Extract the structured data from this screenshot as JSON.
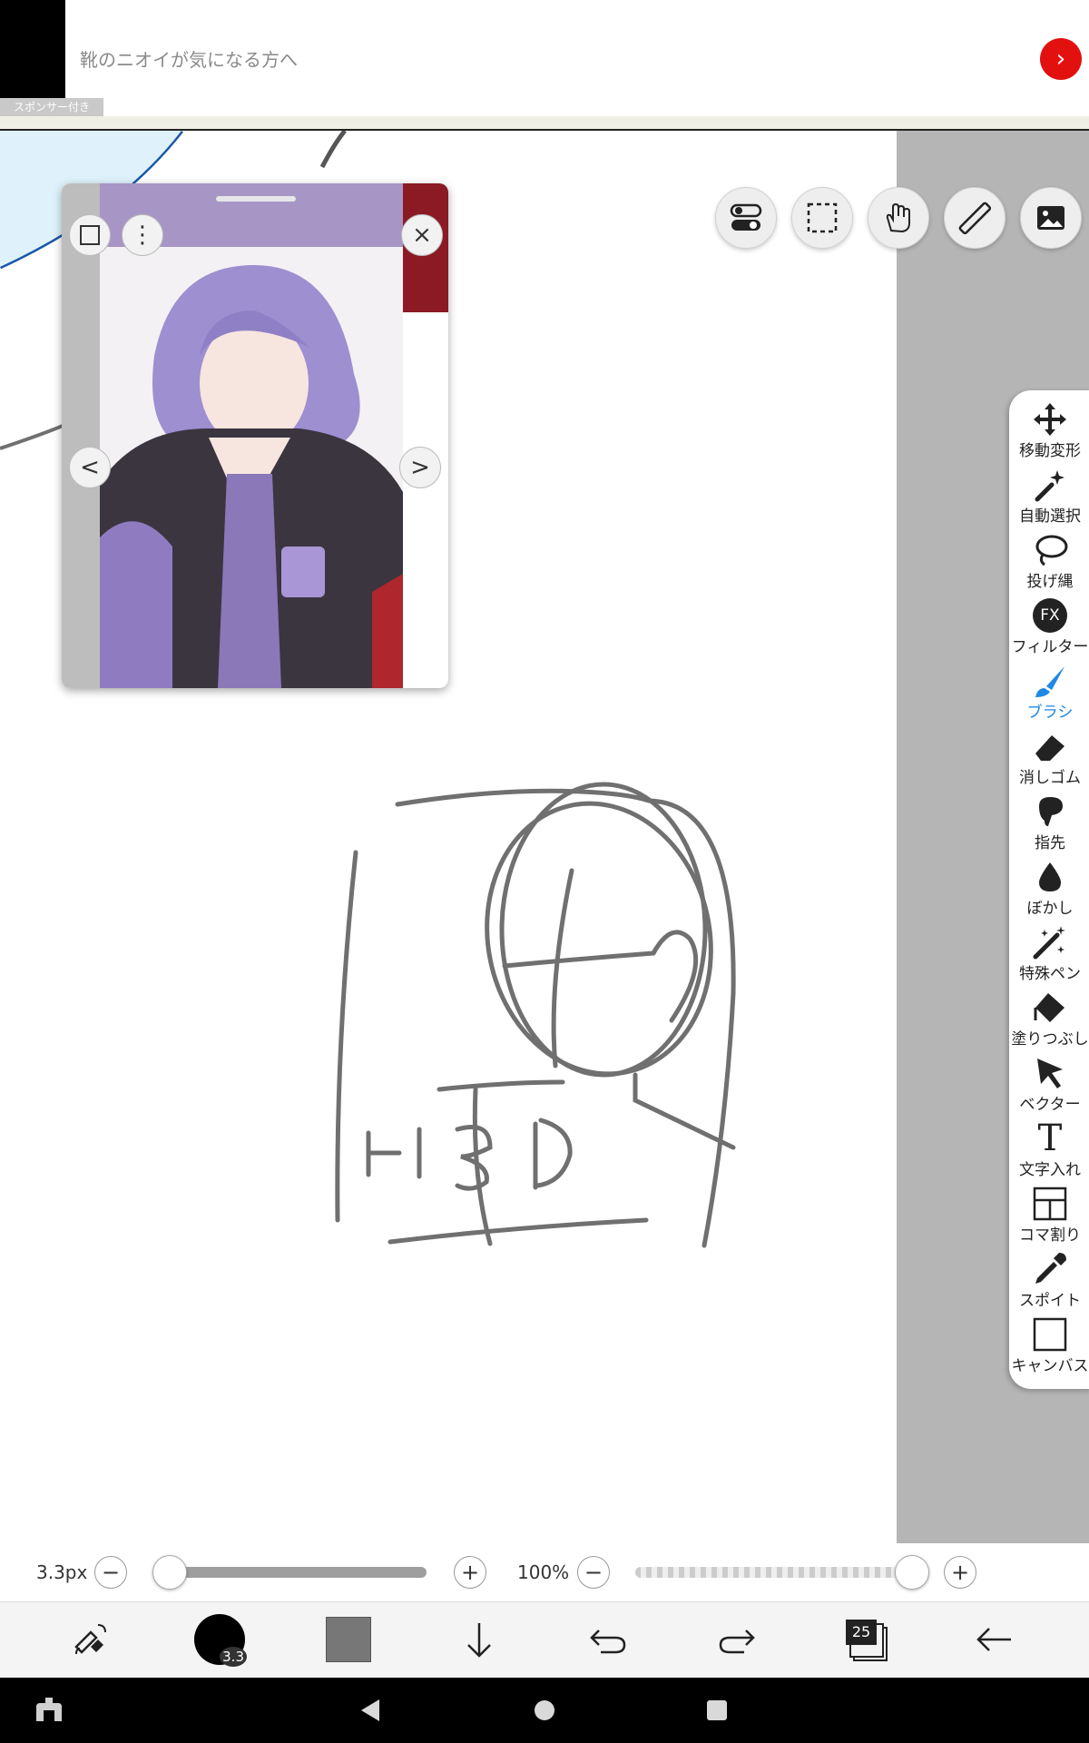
{
  "ad": {
    "text": "靴のニオイが気になる方へ",
    "sponsor": "スポンサー付き",
    "go_glyph": "›"
  },
  "reference_panel": {
    "prev_glyph": "<",
    "next_glyph": ">",
    "close_glyph": "×",
    "menu_glyph": "⋮"
  },
  "top_tools": [
    "toggle-icon",
    "selection-icon",
    "hand-icon",
    "ruler-icon",
    "image-icon"
  ],
  "toolbar": {
    "items": [
      {
        "label": "移動変形",
        "icon": "move-icon"
      },
      {
        "label": "自動選択",
        "icon": "magic-wand-icon"
      },
      {
        "label": "投げ縄",
        "icon": "lasso-icon"
      },
      {
        "label": "フィルター",
        "icon": "fx-icon",
        "icon_text": "FX"
      },
      {
        "label": "ブラシ",
        "icon": "brush-icon",
        "active": true
      },
      {
        "label": "消しゴム",
        "icon": "eraser-icon"
      },
      {
        "label": "指先",
        "icon": "finger-icon"
      },
      {
        "label": "ぼかし",
        "icon": "blur-icon"
      },
      {
        "label": "特殊ペン",
        "icon": "special-pen-icon"
      },
      {
        "label": "塗りつぶし",
        "icon": "fill-icon"
      },
      {
        "label": "ベクター",
        "icon": "vector-icon"
      },
      {
        "label": "文字入れ",
        "icon": "text-icon",
        "icon_text": "T"
      },
      {
        "label": "コマ割り",
        "icon": "panel-icon"
      },
      {
        "label": "スポイト",
        "icon": "eyedropper-icon"
      },
      {
        "label": "キャンバス",
        "icon": "canvas-icon"
      }
    ],
    "active_color": "#1e88e5"
  },
  "brush": {
    "size_label": "3.3px",
    "size_fraction": 0.0,
    "opacity_label": "100%",
    "opacity_fraction": 1.0,
    "minus": "−",
    "plus": "+"
  },
  "bottom_bar": {
    "brush_size_badge": "3.3",
    "layer_count": "25",
    "color_swatch": "#777777",
    "icons": [
      "swap-icon",
      "brush-size-icon",
      "color-swatch",
      "down-arrow-icon",
      "undo-icon",
      "redo-icon",
      "layers-icon",
      "back-icon"
    ]
  },
  "navbar": {
    "icons": [
      "keyboard-icon",
      "back-triangle-icon",
      "home-circle-icon",
      "recents-square-icon"
    ]
  },
  "colors": {
    "ad_button": "#e31010",
    "canvas_gray": "#b5b5b5",
    "stroke": "#6e6e6e"
  }
}
